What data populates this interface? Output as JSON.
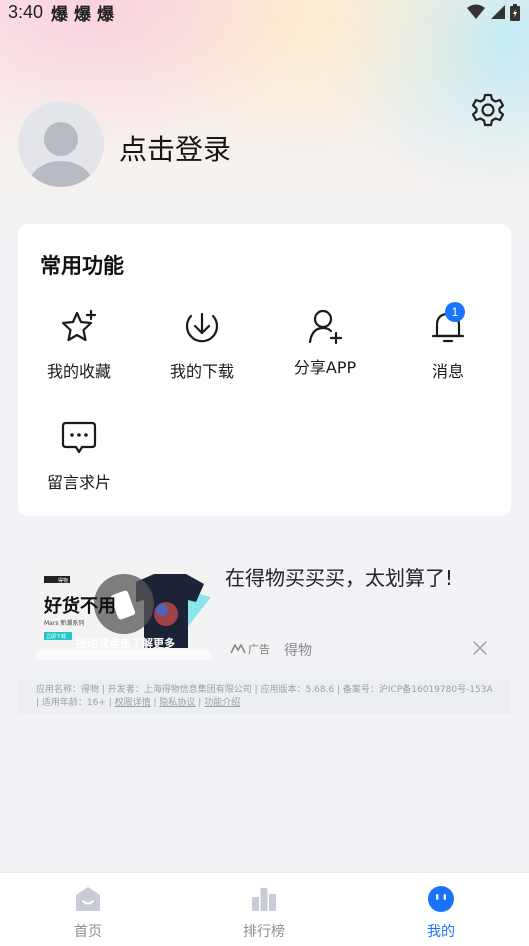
{
  "status_bar": {
    "time": "3:40",
    "notification_glyphs": [
      "爆",
      "爆",
      "爆"
    ]
  },
  "profile": {
    "login_label": "点击登录"
  },
  "common_functions": {
    "title": "常用功能",
    "items": [
      {
        "label": "我的收藏",
        "icon": "star-icon"
      },
      {
        "label": "我的下载",
        "icon": "download-icon"
      },
      {
        "label": "分享APP",
        "icon": "share-user-icon"
      },
      {
        "label": "消息",
        "icon": "bell-icon",
        "badge": "1"
      },
      {
        "label": "留言求片",
        "icon": "message-icon"
      }
    ]
  },
  "ad": {
    "title": "在得物买买买，太划算了!",
    "tag": "广告",
    "source": "得物",
    "image": {
      "headline": "好货不用",
      "overlay_text": "扭动或点击了解更多",
      "brand": "得物",
      "caption": "Mars 新潮系列",
      "button": "立即下载"
    }
  },
  "app_info": {
    "text": "应用名称：得物 | 开发者：上海得物信息集团有限公司 | 应用版本：5.68.6 | 备案号：沪ICP备16019780号-153A | 适用年龄：16+ | ",
    "links": [
      "权限详情",
      "隐私协议",
      "功能介绍"
    ]
  },
  "tabbar": {
    "tabs": [
      {
        "label": "首页",
        "icon": "home-icon",
        "active": false
      },
      {
        "label": "排行榜",
        "icon": "ranking-icon",
        "active": false
      },
      {
        "label": "我的",
        "icon": "profile-face-icon",
        "active": true
      }
    ]
  },
  "colors": {
    "accent": "#1a73ff",
    "badge": "#1a73ff",
    "background": "#f2f3f6"
  }
}
